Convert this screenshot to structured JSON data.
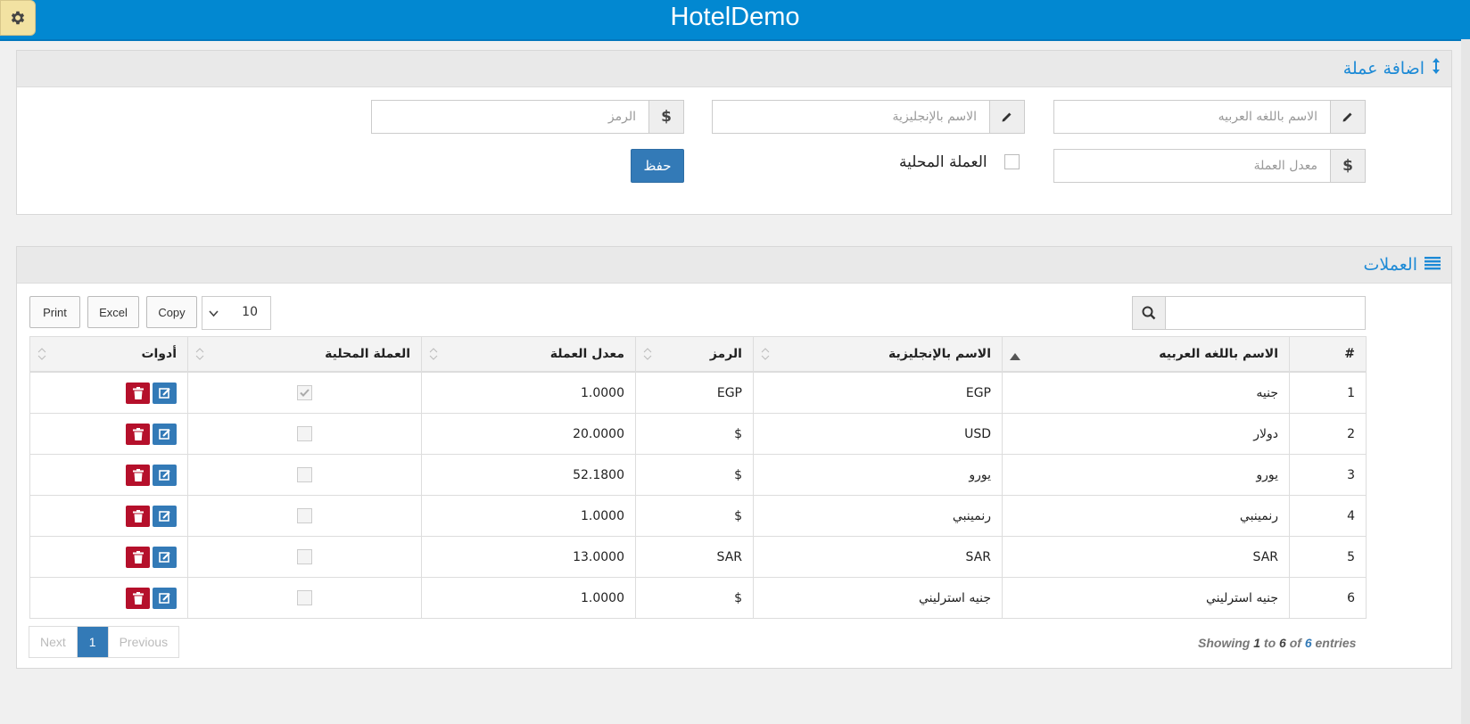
{
  "app": {
    "title": "HotelDemo"
  },
  "add_panel": {
    "title": "اضافة عملة",
    "fields": {
      "arabic_name": {
        "placeholder": "الاسم باللغه العربيه",
        "addon": "pencil-icon"
      },
      "english_name": {
        "placeholder": "الاسم بالإنجليزية",
        "addon": "pencil-icon"
      },
      "symbol": {
        "placeholder": "الرمز",
        "addon": "$"
      },
      "rate": {
        "placeholder": "معدل العملة",
        "addon": "$"
      }
    },
    "local_currency_label": "العملة المحلية",
    "save_label": "حفظ"
  },
  "list_panel": {
    "title": "العملات",
    "buttons": {
      "print": "Print",
      "excel": "Excel",
      "copy": "Copy"
    },
    "page_length": "10",
    "search_value": "",
    "columns": [
      "#",
      "الاسم باللغه العربيه",
      "الاسم بالإنجليزية",
      "الرمز",
      "معدل العملة",
      "العملة المحلية",
      "أدوات"
    ],
    "rows": [
      {
        "num": "1",
        "ar": "جنيه",
        "en": "EGP",
        "sym": "EGP",
        "rate": "1.0000",
        "local": true
      },
      {
        "num": "2",
        "ar": "دولار",
        "en": "USD",
        "sym": "$",
        "rate": "20.0000",
        "local": false
      },
      {
        "num": "3",
        "ar": "يورو",
        "en": "يورو",
        "sym": "$",
        "rate": "52.1800",
        "local": false
      },
      {
        "num": "4",
        "ar": "رنمينبي",
        "en": "رنمينبي",
        "sym": "$",
        "rate": "1.0000",
        "local": false
      },
      {
        "num": "5",
        "ar": "SAR",
        "en": "SAR",
        "sym": "SAR",
        "rate": "13.0000",
        "local": false
      },
      {
        "num": "6",
        "ar": "جنيه استرليني",
        "en": "جنيه استرليني",
        "sym": "$",
        "rate": "1.0000",
        "local": false
      }
    ],
    "info": {
      "prefix": "Showing",
      "from": "1",
      "to_word": "to",
      "to": "6",
      "of_word": "of",
      "total": "6",
      "suffix": "entries"
    },
    "pager": {
      "next": "Next",
      "current": "1",
      "previous": "Previous"
    }
  }
}
